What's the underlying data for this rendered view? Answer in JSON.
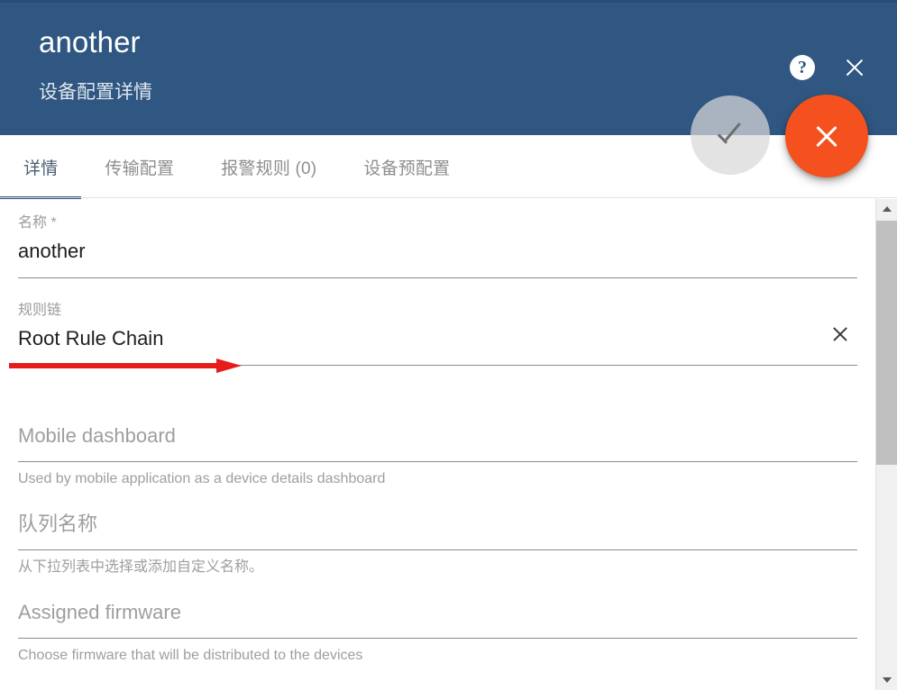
{
  "header": {
    "title": "another",
    "subtitle": "设备配置详情",
    "bg_color": "#2f5781",
    "help_icon_label": "?",
    "help_icon_name": "help-icon",
    "close_icon_name": "close-icon"
  },
  "fabs": {
    "save_label": "✓",
    "save_state": "disabled",
    "save_color": "#d8d8d8",
    "close_label": "✕",
    "close_color": "#f4511e"
  },
  "tabs": {
    "items": [
      {
        "label": "详情",
        "active": true
      },
      {
        "label": "传输配置",
        "active": false
      },
      {
        "label": "报警规则 (0)",
        "active": false
      },
      {
        "label": "设备预配置",
        "active": false
      }
    ],
    "active_indicator_color": "#2f5781"
  },
  "form": {
    "fields": [
      {
        "label": "名称 *",
        "value": "another",
        "hint": "",
        "has_clear": false
      },
      {
        "label": "规则链",
        "value": "Root Rule Chain",
        "hint": "",
        "has_clear": true,
        "clear_icon_name": "clear-icon"
      },
      {
        "label": "",
        "placeholder": "Mobile dashboard",
        "hint": "Used by mobile application as a device details dashboard",
        "has_clear": false
      },
      {
        "label": "",
        "placeholder": "队列名称",
        "hint": "从下拉列表中选择或添加自定义名称。",
        "has_clear": false
      },
      {
        "label": "",
        "placeholder": "Assigned firmware",
        "hint": "Choose firmware that will be distributed to the devices",
        "has_clear": false
      }
    ]
  },
  "annotation": {
    "type": "arrow",
    "color": "#e81b1b",
    "direction": "right",
    "points_at": "Root Rule Chain"
  },
  "scrollbar": {
    "up_arrow": "▲",
    "down_arrow": "▼",
    "position": "top"
  }
}
